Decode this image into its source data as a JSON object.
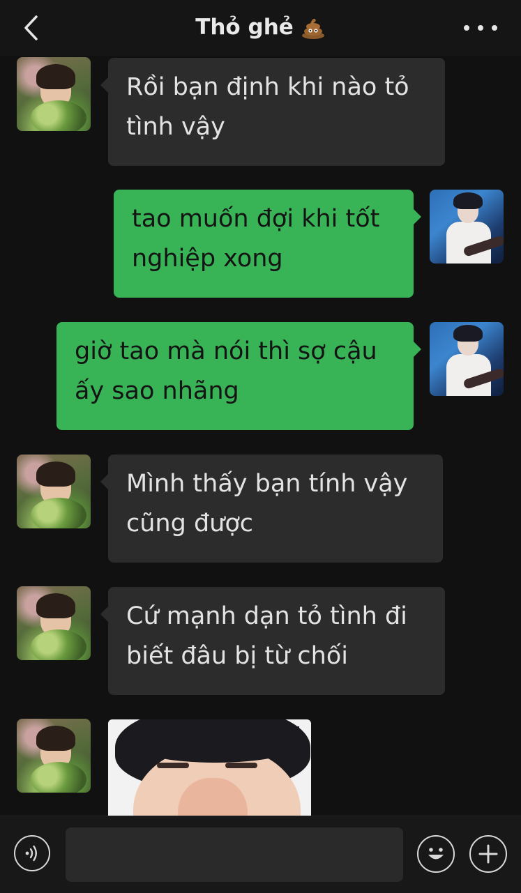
{
  "header": {
    "title": "Thỏ ghẻ",
    "title_emoji_icon": "pile-of-poo-icon",
    "back_icon": "chevron-left-icon",
    "more_icon": "more-dots-icon"
  },
  "messages": [
    {
      "side": "left",
      "lines": [
        "Rồi bạn định khi nào tỏ",
        "tình vậy"
      ]
    },
    {
      "side": "right",
      "lines": [
        "tao muốn đợi khi tốt",
        "nghiệp xong"
      ]
    },
    {
      "side": "right",
      "lines": [
        "giờ tao mà nói thì sợ cậu",
        "ấy sao nhãng"
      ]
    },
    {
      "side": "left",
      "lines": [
        "Mình thấy bạn tính vậy",
        "cũng được"
      ]
    },
    {
      "side": "left",
      "lines": [
        "Cứ mạnh dạn tỏ tình đi",
        "biết đâu bị từ chối"
      ]
    },
    {
      "side": "left",
      "type": "image"
    }
  ],
  "footer": {
    "voice_icon": "voice-icon",
    "input_value": "",
    "emoji_icon": "emoji-icon",
    "plus_icon": "plus-icon"
  },
  "colors": {
    "background": "#111111",
    "incoming_bubble": "#2c2c2c",
    "outgoing_bubble": "#38b457",
    "text_light": "#e3e3e3"
  }
}
